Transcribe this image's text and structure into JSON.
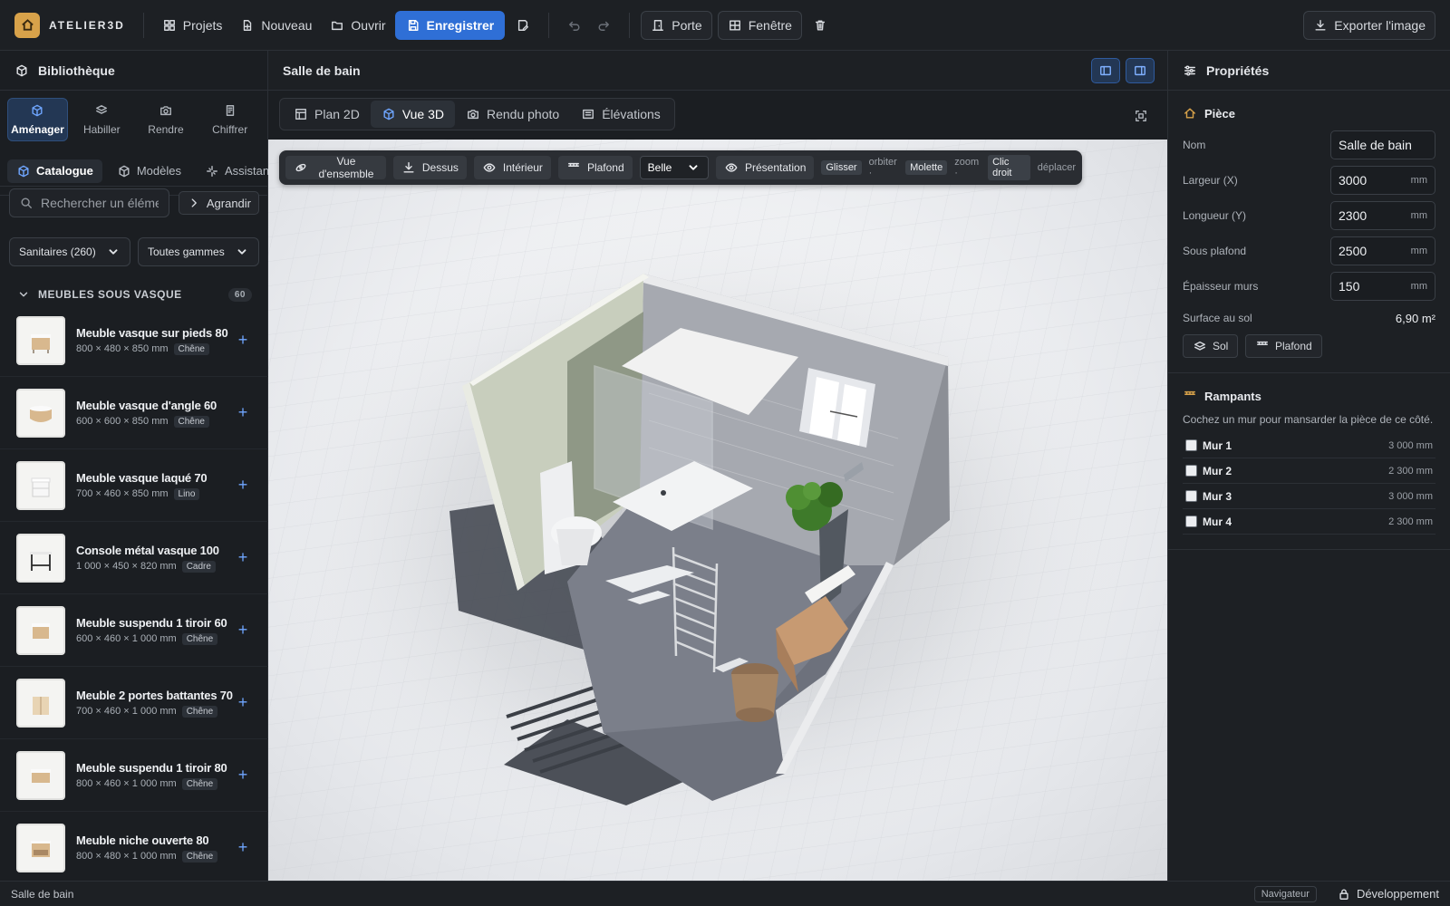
{
  "app": {
    "brand": "ATELIER3D"
  },
  "toolbar": {
    "projects": "Projets",
    "new": "Nouveau",
    "open": "Ouvrir",
    "save": "Enregistrer",
    "door": "Porte",
    "window": "Fenêtre",
    "export": "Exporter l'image"
  },
  "library": {
    "title": "Bibliothèque",
    "modes": [
      "Aménager",
      "Habiller",
      "Rendre",
      "Chiffrer"
    ],
    "subtabs": [
      "Catalogue",
      "Modèles",
      "Assistant"
    ],
    "search_placeholder": "Rechercher un élémen",
    "expand": "Agrandir",
    "filter_category": "Sanitaires (260)",
    "filter_range": "Toutes gammes",
    "category": {
      "name": "MEUBLES SOUS VASQUE",
      "count": "60"
    },
    "items": [
      {
        "name": "Meuble vasque sur pieds 80",
        "dims": "800 × 480 × 850 mm",
        "tag": "Chêne"
      },
      {
        "name": "Meuble vasque d'angle 60",
        "dims": "600 × 600 × 850 mm",
        "tag": "Chêne"
      },
      {
        "name": "Meuble vasque laqué 70",
        "dims": "700 × 460 × 850 mm",
        "tag": "Lino"
      },
      {
        "name": "Console métal vasque 100",
        "dims": "1 000 × 450 × 820 mm",
        "tag": "Cadre"
      },
      {
        "name": "Meuble suspendu 1 tiroir 60",
        "dims": "600 × 460 × 1 000 mm",
        "tag": "Chêne"
      },
      {
        "name": "Meuble 2 portes battantes 70",
        "dims": "700 × 460 × 1 000 mm",
        "tag": "Chêne"
      },
      {
        "name": "Meuble suspendu 1 tiroir 80",
        "dims": "800 × 460 × 1 000 mm",
        "tag": "Chêne"
      },
      {
        "name": "Meuble niche ouverte 80",
        "dims": "800 × 480 × 1 000 mm",
        "tag": "Chêne"
      }
    ]
  },
  "canvas": {
    "title": "Salle de bain",
    "views": [
      "Plan 2D",
      "Vue 3D",
      "Rendu photo",
      "Élévations"
    ],
    "tools": {
      "overview": "Vue d'ensemble",
      "top": "Dessus",
      "interior": "Intérieur",
      "ceiling": "Plafond",
      "quality": "Belle",
      "presentation": "Présentation"
    },
    "hints": {
      "drag_key": "Glisser",
      "drag_action": "orbiter ·",
      "wheel_key": "Molette",
      "wheel_action": "zoom ·",
      "right_key": "Clic droit",
      "right_action": "déplacer"
    }
  },
  "properties": {
    "title": "Propriétés",
    "room": {
      "heading": "Pièce",
      "name_label": "Nom",
      "name_value": "Salle de bain",
      "width_label": "Largeur (X)",
      "width_value": "3000",
      "length_label": "Longueur (Y)",
      "length_value": "2300",
      "ceiling_label": "Sous plafond",
      "ceiling_value": "2500",
      "wall_label": "Épaisseur murs",
      "wall_value": "150",
      "unit": "mm",
      "area_label": "Surface au sol",
      "area_value": "6,90 m²",
      "floor_btn": "Sol",
      "ceiling_btn": "Plafond"
    },
    "slopes": {
      "heading": "Rampants",
      "note": "Cochez un mur pour mansarder la pièce de ce côté.",
      "walls": [
        {
          "name": "Mur 1",
          "length": "3 000 mm"
        },
        {
          "name": "Mur 2",
          "length": "2 300 mm"
        },
        {
          "name": "Mur 3",
          "length": "3 000 mm"
        },
        {
          "name": "Mur 4",
          "length": "2 300 mm"
        }
      ]
    }
  },
  "status": {
    "room": "Salle de bain",
    "browser": "Navigateur",
    "mode": "Développement"
  },
  "colors": {
    "accent": "#2f6fd6",
    "brand": "#d8a24a",
    "background": "#1b1e22"
  }
}
